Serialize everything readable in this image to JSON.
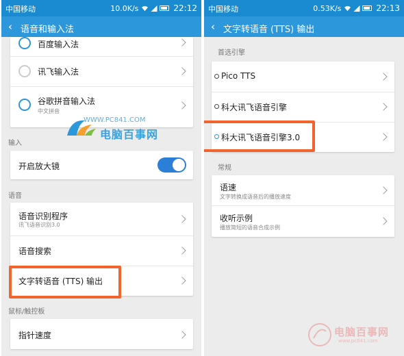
{
  "left": {
    "status": {
      "carrier": "中国移动",
      "speed": "10.0K/s",
      "time": "22:12"
    },
    "title": "语音和输入法",
    "ime_items": [
      {
        "label": "百度输入法",
        "selected": true
      },
      {
        "label": "讯飞输入法",
        "selected": false
      },
      {
        "label": "谷歌拼音输入法",
        "sub": "中文拼音",
        "selected": true
      }
    ],
    "input_section": "输入",
    "magnifier": {
      "label": "开启放大镜",
      "on": true
    },
    "voice_section": "语音",
    "voice_items": [
      {
        "label": "语音识别程序",
        "sub": "讯飞语音识别3.0"
      },
      {
        "label": "语音搜索"
      },
      {
        "label": "文字转语音 (TTS) 输出"
      }
    ],
    "mouse_section": "鼠标/触控板",
    "pointer_speed": "指针速度"
  },
  "right": {
    "status": {
      "carrier": "中国移动",
      "speed": "0.53K/s",
      "time": "22:13"
    },
    "title": "文字转语音 (TTS) 输出",
    "engine_section": "首选引擎",
    "engines": [
      {
        "label": "Pico TTS",
        "selected": false
      },
      {
        "label": "科大讯飞语音引擎",
        "selected": false
      },
      {
        "label": "科大讯飞语音引擎3.0",
        "selected": true
      }
    ],
    "general_section": "常规",
    "general_items": [
      {
        "label": "语速",
        "sub": "文字转换成语音后的播放速度"
      },
      {
        "label": "收听示例",
        "sub": "播放简短的语音合成示例"
      }
    ]
  },
  "watermark": {
    "url": "WWW.PC841.COM",
    "name": "电脑百事网"
  },
  "watermark2": {
    "name": "电脑百事网",
    "url": "www.pc841.com"
  },
  "colors": {
    "statusbar": "#1a8bd1",
    "appbar": "#2c97db",
    "highlight": "#f2642d",
    "toggle": "#2c7fd6"
  }
}
